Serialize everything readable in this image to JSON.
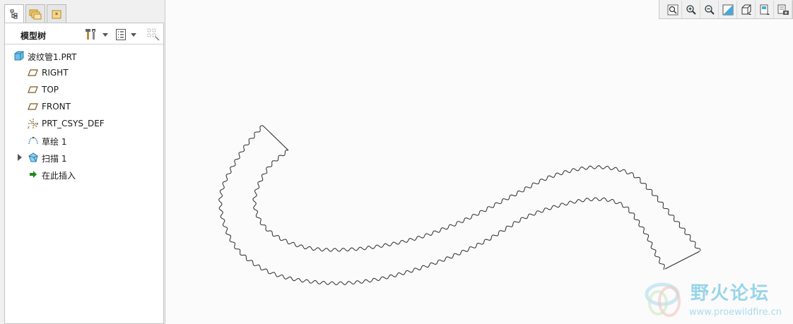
{
  "panel": {
    "tabs": [
      {
        "icon": "model-tree-tab-icon",
        "active": true
      },
      {
        "icon": "folder-browser-tab-icon",
        "active": false
      },
      {
        "icon": "favorites-tab-icon",
        "active": false
      }
    ],
    "title": "模型树"
  },
  "tree": {
    "items": [
      {
        "label": "波纹管1.PRT",
        "icon": "part-icon"
      },
      {
        "label": "RIGHT",
        "icon": "datum-plane-icon"
      },
      {
        "label": "TOP",
        "icon": "datum-plane-icon"
      },
      {
        "label": "FRONT",
        "icon": "datum-plane-icon"
      },
      {
        "label": "PRT_CSYS_DEF",
        "icon": "coordinate-system-icon"
      },
      {
        "label": "草绘 1",
        "icon": "sketch-icon"
      },
      {
        "label": "扫描 1",
        "icon": "sweep-icon",
        "expandable": true
      },
      {
        "label": "在此插入",
        "icon": "insert-here-icon"
      }
    ]
  },
  "toolbar": {
    "buttons": [
      "refit-icon",
      "zoom-in-icon",
      "zoom-out-icon",
      "repaint-icon",
      "display-style-icon",
      "saved-views-icon",
      "view-manager-icon"
    ]
  },
  "colors": {
    "insert_arrow": "#1a8a1a",
    "part": "#4aa8d8",
    "watermark": "#87cfe8"
  },
  "watermark": {
    "title": "野火论坛",
    "url": "www.proewildfire.cn"
  }
}
